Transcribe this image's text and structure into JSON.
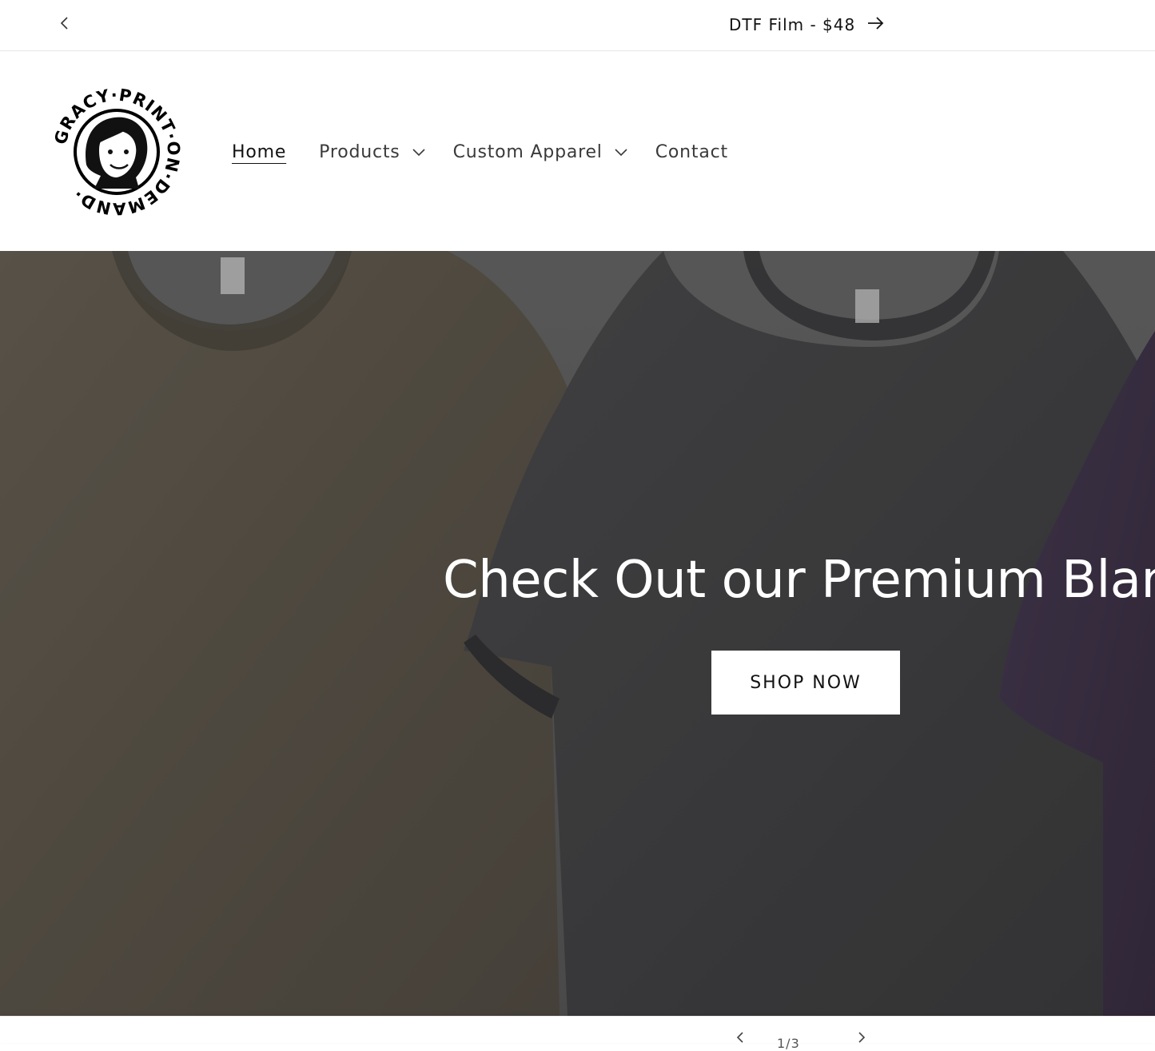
{
  "announcement": {
    "message": "DTF Film - $48",
    "prev_icon": "chevron-left-icon",
    "arrow_icon": "arrow-right-icon"
  },
  "header": {
    "logo_text": "GRACY·PRINT·ON·DEMAND·",
    "nav": {
      "home": "Home",
      "products": "Products",
      "custom_apparel": "Custom Apparel",
      "contact": "Contact"
    }
  },
  "hero": {
    "heading": "Check Out our Premium Blanks",
    "button_label": "SHOP NOW"
  },
  "slideshow": {
    "counter": "1/3"
  },
  "colors": {
    "background": "#ffffff",
    "text": "#121212",
    "hero_overlay": "#000000",
    "button_bg": "#ffffff"
  }
}
